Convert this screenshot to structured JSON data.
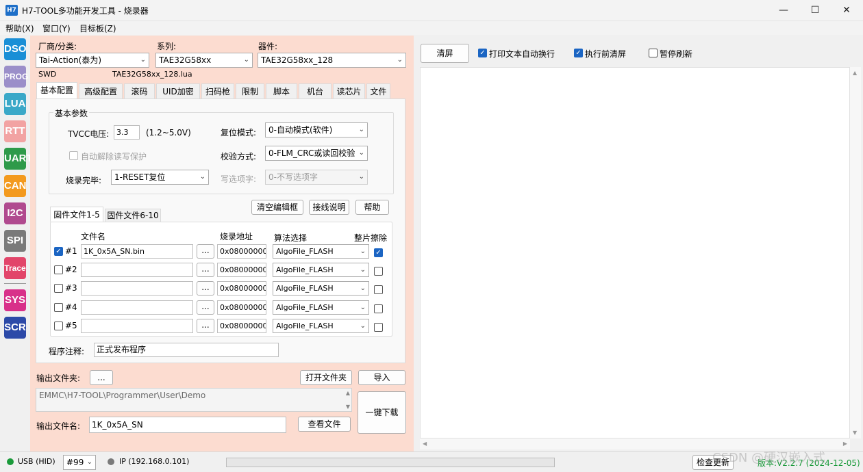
{
  "window": {
    "title": "H7-TOOL多功能开发工具 - 烧录器",
    "icon_text": "H7"
  },
  "menu": [
    "帮助(X)",
    "窗口(Y)",
    "目标板(Z)"
  ],
  "sidebar": [
    {
      "label": "DSO",
      "color": "#1a8fd6"
    },
    {
      "label": "PROG",
      "color": "#9b8fc9"
    },
    {
      "label": "LUA",
      "color": "#3aa8c8"
    },
    {
      "label": "RTT",
      "color": "#f2a3a3"
    },
    {
      "label": "UART",
      "color": "#2e9a4a"
    },
    {
      "label": "CAN",
      "color": "#f39a1e"
    },
    {
      "label": "I2C",
      "color": "#b04a8f"
    },
    {
      "label": "SPI",
      "color": "#7a7a7a"
    },
    {
      "label": "Trace",
      "color": "#e2456a"
    },
    {
      "label": "SYS",
      "color": "#d8308a"
    },
    {
      "label": "SCR",
      "color": "#2c4aa8"
    }
  ],
  "selectors": {
    "vendor_label": "厂商/分类:",
    "vendor_value": "Tai-Action(泰为)",
    "series_label": "系列:",
    "series_value": "TAE32G58xx",
    "device_label": "器件:",
    "device_value": "TAE32G58xx_128",
    "interface": "SWD",
    "lua_file": "TAE32G58xx_128.lua"
  },
  "tabs": [
    "基本配置",
    "高级配置",
    "滚码",
    "UID加密",
    "扫码枪",
    "限制",
    "脚本",
    "机台",
    "读芯片",
    "文件"
  ],
  "basic": {
    "group_title": "基本参数",
    "tvcc_label": "TVCC电压:",
    "tvcc_value": "3.3",
    "tvcc_range": "(1.2~5.0V)",
    "reset_label": "复位模式:",
    "reset_value": "0-自动模式(软件)",
    "auto_unprotect_label": "自动解除读写保护",
    "verify_label": "校验方式:",
    "verify_value": "0-FLM_CRC或读回校验",
    "finish_label": "烧录完毕:",
    "finish_value": "1-RESET复位",
    "option_label": "写选项字:",
    "option_value": "0-不写选项字"
  },
  "buttons": {
    "clear_editor": "清空编辑框",
    "wiring": "接线说明",
    "help": "帮助"
  },
  "fw_tabs": [
    "固件文件1-5",
    "固件文件6-10"
  ],
  "fw_headers": {
    "file": "文件名",
    "addr": "烧录地址",
    "algo": "算法选择",
    "erase": "整片擦除"
  },
  "fw_rows": [
    {
      "id": "#1",
      "checked": true,
      "file": "1K_0x5A_SN.bin",
      "browse": "...",
      "addr": "0x08000000",
      "algo": "AlgoFile_FLASH",
      "erase": true
    },
    {
      "id": "#2",
      "checked": false,
      "file": "",
      "browse": "...",
      "addr": "0x08000000",
      "algo": "AlgoFile_FLASH",
      "erase": false
    },
    {
      "id": "#3",
      "checked": false,
      "file": "",
      "browse": "...",
      "addr": "0x08000000",
      "algo": "AlgoFile_FLASH",
      "erase": false
    },
    {
      "id": "#4",
      "checked": false,
      "file": "",
      "browse": "...",
      "addr": "0x08000000",
      "algo": "AlgoFile_FLASH",
      "erase": false
    },
    {
      "id": "#5",
      "checked": false,
      "file": "",
      "browse": "...",
      "addr": "0x08000000",
      "algo": "AlgoFile_FLASH",
      "erase": false
    }
  ],
  "note": {
    "label": "程序注释:",
    "value": "正式发布程序"
  },
  "output": {
    "folder_label": "输出文件夹:",
    "folder_btn": "...",
    "open_folder": "打开文件夹",
    "import": "导入",
    "path": "EMMC\\H7-TOOL\\Programmer\\User\\Demo",
    "one_click": "一键下载",
    "name_label": "输出文件名:",
    "name_value": "1K_0x5A_SN",
    "view_file": "查看文件"
  },
  "right": {
    "clear": "清屏",
    "wrap_label": "打印文本自动换行",
    "wrap_checked": true,
    "clear_before_label": "执行前清屏",
    "clear_before_checked": true,
    "pause_label": "暂停刷新",
    "pause_checked": false
  },
  "status": {
    "usb": "USB (HID)",
    "usb_color": "#1a9a3a",
    "device_no": "#99",
    "ip": "IP (192.168.0.101)",
    "ip_color": "#7a7a7a",
    "check_update": "检查更新",
    "version": "版本:V2.2.7 (2024-12-05)",
    "version_color": "#1a9a3a",
    "watermark": "CSDN @硬汉嵌入式"
  }
}
